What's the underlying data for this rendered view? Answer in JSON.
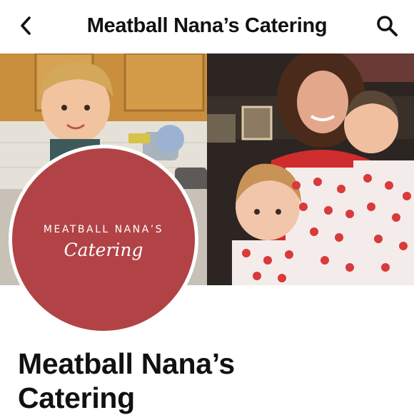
{
  "header": {
    "title": "Meatball Nana’s Catering",
    "back_icon": "chevron-left-icon",
    "search_icon": "search-icon"
  },
  "profile": {
    "logo_line1": "MEATBALL NANA’S",
    "logo_line2": "Catering",
    "logo_color": "#b14347"
  },
  "page": {
    "name_line1": "Meatball Nana’s",
    "name_line2": "Catering"
  }
}
